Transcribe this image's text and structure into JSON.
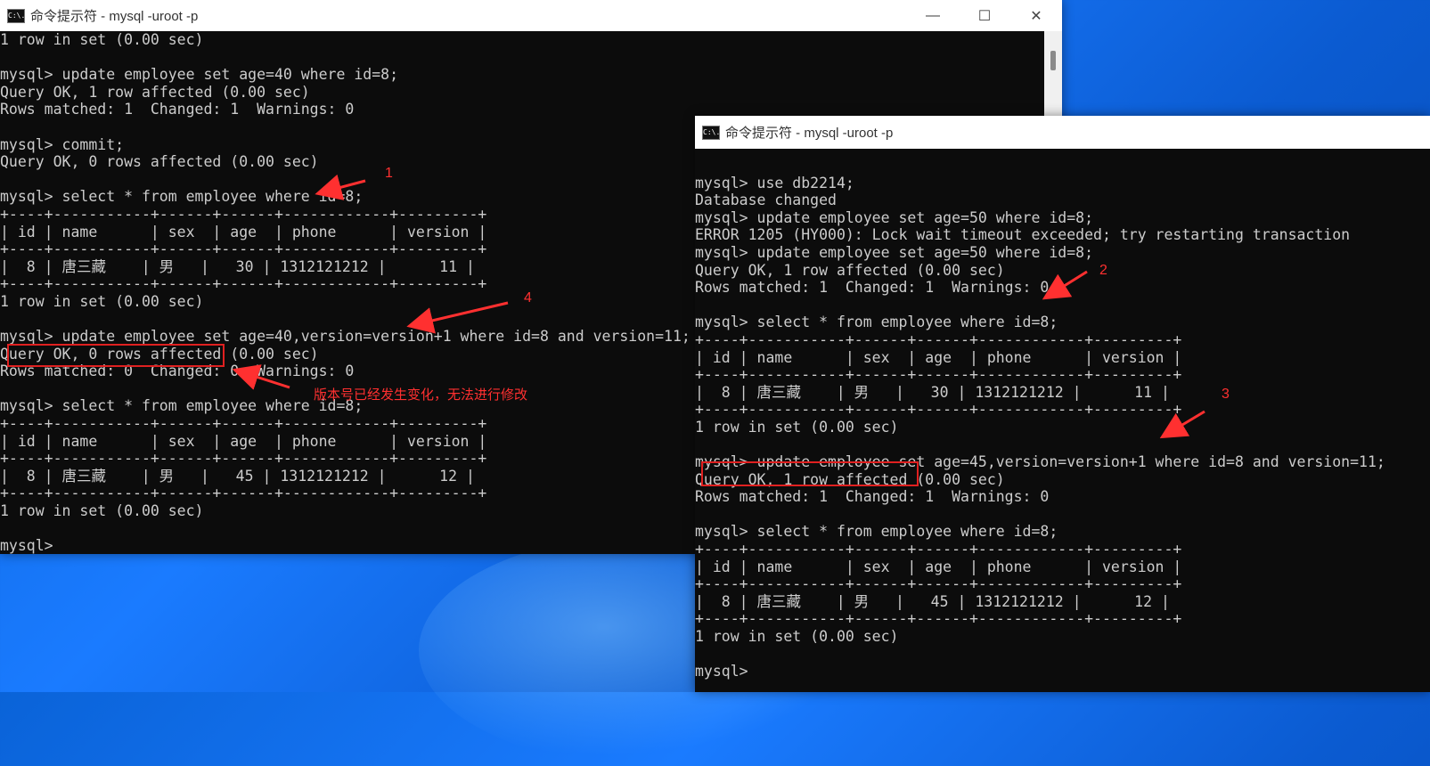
{
  "window1": {
    "title": "命令提示符 - mysql  -uroot -p",
    "icon_label": "C:\\.",
    "controls": {
      "minimize": "—",
      "maximize": "☐",
      "close": "✕"
    },
    "lines": [
      "1 row in set (0.00 sec)",
      "",
      "mysql> update employee set age=40 where id=8;",
      "Query OK, 1 row affected (0.00 sec)",
      "Rows matched: 1  Changed: 1  Warnings: 0",
      "",
      "mysql> commit;",
      "Query OK, 0 rows affected (0.00 sec)",
      "",
      "mysql> select * from employee where id=8;",
      "+----+-----------+------+------+------------+---------+",
      "| id | name      | sex  | age  | phone      | version |",
      "+----+-----------+------+------+------------+---------+",
      "|  8 | 唐三藏    | 男   |   30 | 1312121212 |      11 |",
      "+----+-----------+------+------+------------+---------+",
      "1 row in set (0.00 sec)",
      "",
      "mysql> update employee set age=40,version=version+1 where id=8 and version=11;",
      "Query OK, 0 rows affected (0.00 sec)",
      "Rows matched: 0  Changed: 0  Warnings: 0",
      "",
      "mysql> select * from employee where id=8;",
      "+----+-----------+------+------+------------+---------+",
      "| id | name      | sex  | age  | phone      | version |",
      "+----+-----------+------+------+------------+---------+",
      "|  8 | 唐三藏    | 男   |   45 | 1312121212 |      12 |",
      "+----+-----------+------+------+------------+---------+",
      "1 row in set (0.00 sec)",
      "",
      "mysql> "
    ]
  },
  "window2": {
    "title": "命令提示符 - mysql  -uroot -p",
    "icon_label": "C:\\.",
    "lines": [
      "",
      "mysql> use db2214;",
      "Database changed",
      "mysql> update employee set age=50 where id=8;",
      "ERROR 1205 (HY000): Lock wait timeout exceeded; try restarting transaction",
      "mysql> update employee set age=50 where id=8;",
      "Query OK, 1 row affected (0.00 sec)",
      "Rows matched: 1  Changed: 1  Warnings: 0",
      "",
      "mysql> select * from employee where id=8;",
      "+----+-----------+------+------+------------+---------+",
      "| id | name      | sex  | age  | phone      | version |",
      "+----+-----------+------+------+------------+---------+",
      "|  8 | 唐三藏    | 男   |   30 | 1312121212 |      11 |",
      "+----+-----------+------+------+------------+---------+",
      "1 row in set (0.00 sec)",
      "",
      "mysql> update employee set age=45,version=version+1 where id=8 and version=11;",
      "Query OK, 1 row affected (0.00 sec)",
      "Rows matched: 1  Changed: 1  Warnings: 0",
      "",
      "mysql> select * from employee where id=8;",
      "+----+-----------+------+------+------------+---------+",
      "| id | name      | sex  | age  | phone      | version |",
      "+----+-----------+------+------+------------+---------+",
      "|  8 | 唐三藏    | 男   |   45 | 1312121212 |      12 |",
      "+----+-----------+------+------+------------+---------+",
      "1 row in set (0.00 sec)",
      "",
      "mysql> "
    ]
  },
  "annotations": {
    "n1": "1",
    "n2": "2",
    "n3": "3",
    "n4": "4",
    "note": "版本号已经发生变化，无法进行修改",
    "color": "#ff3030"
  }
}
